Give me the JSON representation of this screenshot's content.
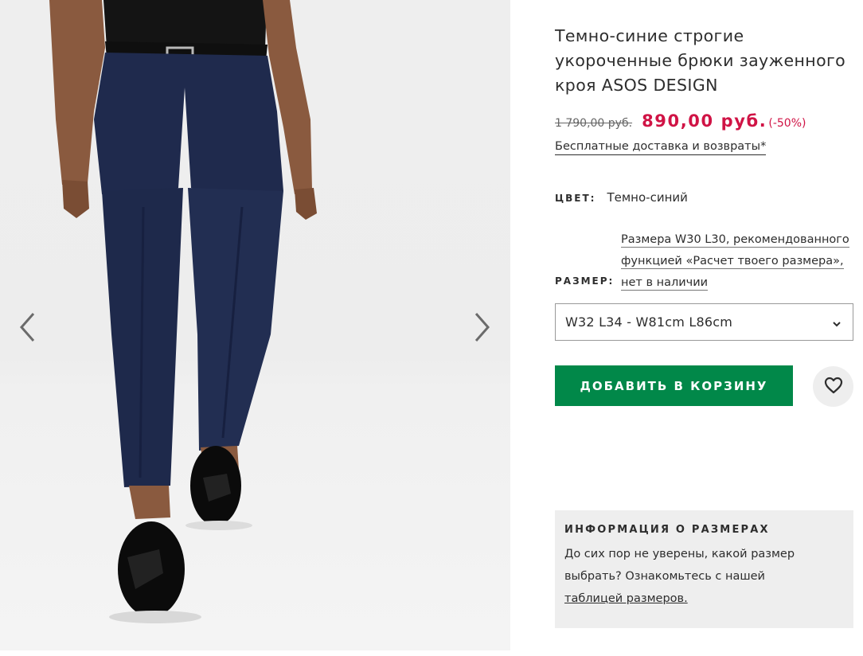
{
  "product": {
    "title": "Темно-синие строгие укороченные брюки зауженного кроя ASOS DESIGN",
    "old_price": "1 790,00 руб.",
    "new_price": "890,00 руб.",
    "discount": "(-50%)",
    "delivery": "Бесплатные доставка и возвраты*",
    "color_label": "ЦВЕТ:",
    "color_value": "Темно-синий",
    "size_note": "Размера W30 L30, рекомендованного функцией «Расчет твоего размера», нет в наличии",
    "size_label": "РАЗМЕР:",
    "size_selected": "W32 L34 - W81cm L86cm",
    "add_to_cart": "ДОБАВИТЬ В КОРЗИНУ"
  },
  "size_info": {
    "heading": "ИНФОРМАЦИЯ О РАЗМЕРАХ",
    "text": "До сих пор не уверены, какой размер выбрать? Ознакомьтесь с нашей",
    "link": "таблицей размеров."
  },
  "icons": {
    "prev": "chevron-left-icon",
    "next": "chevron-right-icon",
    "dropdown": "chevron-down-icon",
    "wishlist": "heart-icon"
  },
  "colors": {
    "sale": "#d01345",
    "cta": "#018849",
    "text": "#2d2d2d",
    "panel": "#eeeeee",
    "trousers": "#1f2a4d"
  }
}
